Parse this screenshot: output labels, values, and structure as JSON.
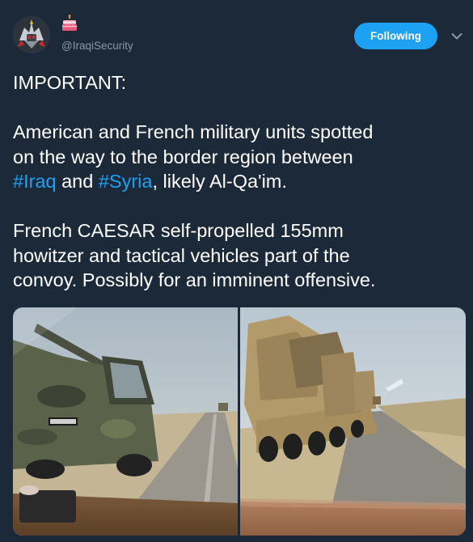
{
  "account": {
    "handle": "@IraqiSecurity",
    "avatar_icon": "robot-avatar-icon",
    "birthday_icon": "birthday-cake-icon"
  },
  "follow_button": {
    "label": "Following"
  },
  "more_menu": {
    "icon": "chevron-down-icon"
  },
  "tweet": {
    "heading": "IMPORTANT:",
    "paragraph1": {
      "before_line1": "American and French military units spotted",
      "before_line2": "on the way to the border region between",
      "hashtag1": "#Iraq",
      "middle": " and ",
      "hashtag2": "#Syria",
      "after": ", likely Al-Qa'im."
    },
    "paragraph2": {
      "line1": "French CAESAR self-propelled 155mm",
      "line2": "howitzer and tactical vehicles part of the",
      "line3": "convoy. Possibly for an imminent offensive."
    }
  },
  "media": {
    "photos": [
      {
        "subject": "caesar-howitzer-photo"
      },
      {
        "subject": "military-convoy-photo"
      }
    ]
  },
  "colors": {
    "background": "#1c2938",
    "accent": "#1da1f2",
    "secondary_text": "#8899a6",
    "primary_text": "#ffffff"
  }
}
